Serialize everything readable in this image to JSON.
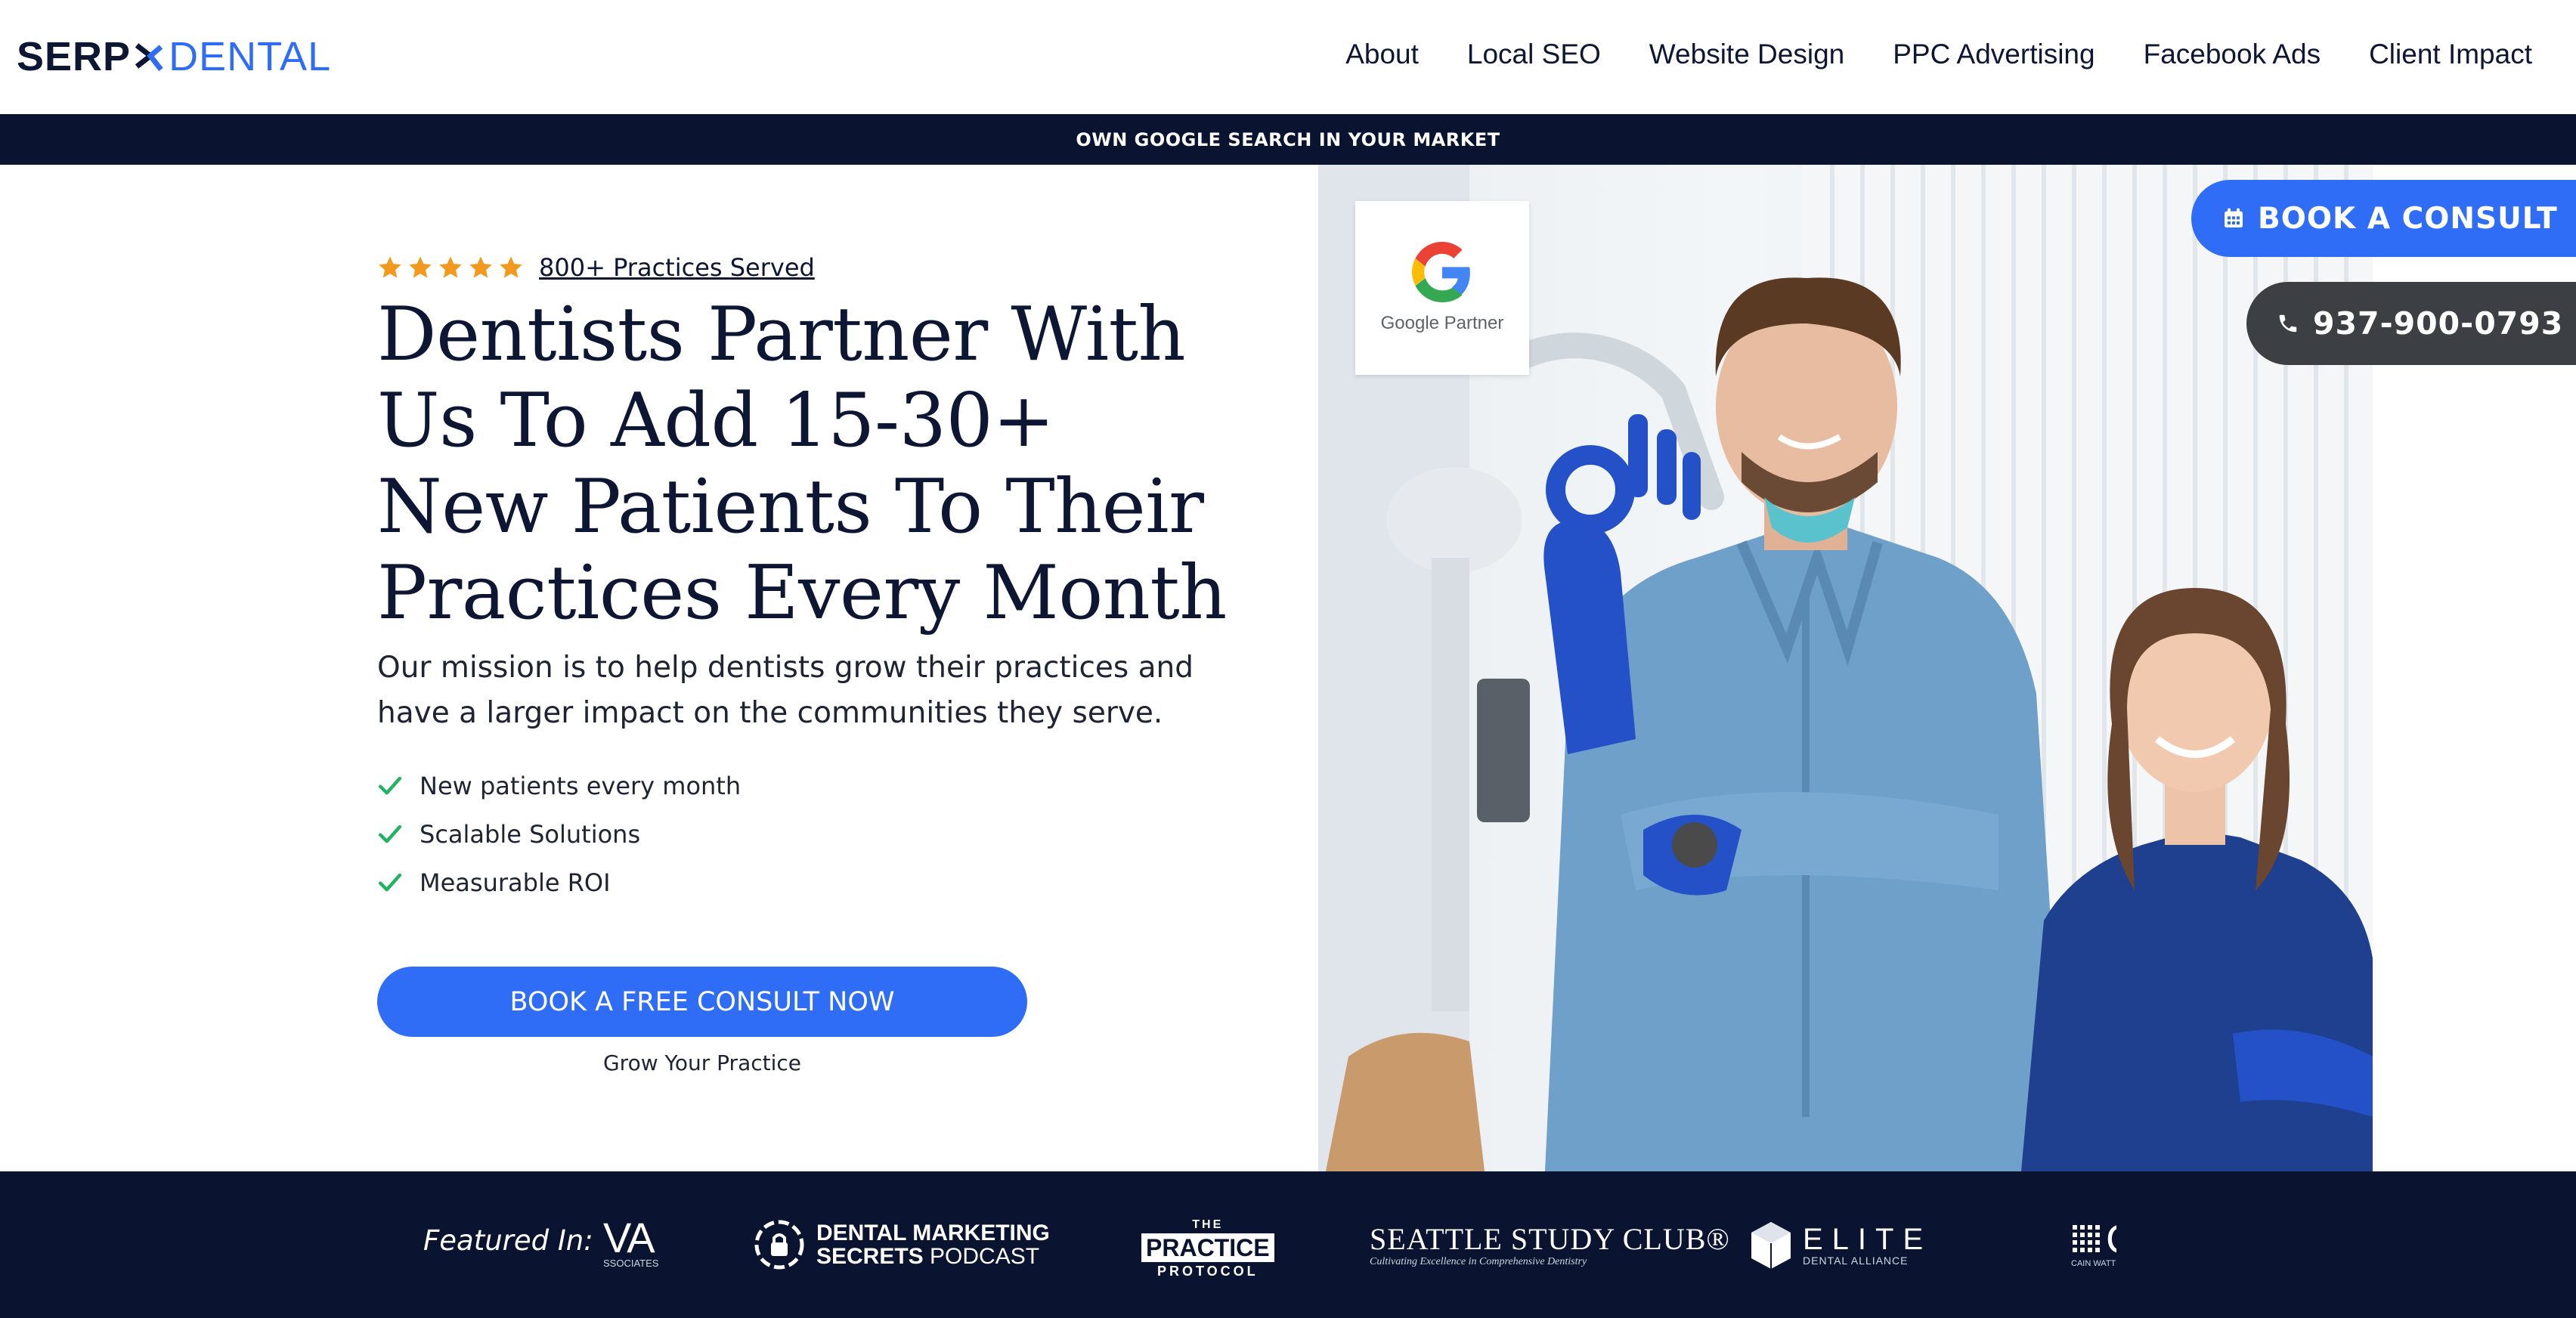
{
  "header": {
    "logo_primary": "SERP",
    "logo_secondary": "DENTAL",
    "nav": [
      "About",
      "Local SEO",
      "Website Design",
      "PPC Advertising",
      "Facebook Ads",
      "Client Impact"
    ]
  },
  "announcement": {
    "text": "OWN GOOGLE SEARCH IN YOUR MARKET"
  },
  "hero": {
    "rating": {
      "stars": 5,
      "text": "800+ Practices Served"
    },
    "headline": "Dentists Partner With Us To Add 15-30+ New Patients To Their Practices Every Month",
    "mission": "Our mission is to help dentists grow their practices and have a larger impact on the communities they serve.",
    "benefits": [
      "New patients every month",
      "Scalable Solutions",
      "Measurable ROI"
    ],
    "cta_label": "BOOK A FREE CONSULT NOW",
    "cta_sub": "Grow Your Practice"
  },
  "badge": {
    "text": "Google Partner"
  },
  "floating": {
    "book_label": "BOOK A CONSULT",
    "phone": "937-900-0793"
  },
  "featured": {
    "label": "Featured In:",
    "logos": {
      "wva": {
        "main": "VA",
        "sub": "SSOCIATES"
      },
      "dms": {
        "line1": "DENTAL MARKETING",
        "line2_bold": "SECRETS",
        "line2_light": " PODCAST"
      },
      "tpp": {
        "top": "THE",
        "middle": "PRACTICE",
        "bottom": "PROTOCOL"
      },
      "ssc": {
        "main": "SEATTLE STUDY CLUB®",
        "tagline": "Cultivating Excellence in Comprehensive Dentistry"
      },
      "elite": {
        "main": "ELITE",
        "sub": "DENTAL ALLIANCE"
      },
      "cw": {
        "main": "CV",
        "sub": "CAIN WATTERS & A"
      }
    }
  },
  "colors": {
    "brand_blue": "#2f6df6",
    "navy": "#0a1430",
    "star": "#f29a1f",
    "check": "#22b35e",
    "phone_bg": "#3c3f44"
  },
  "icons": {
    "book": "calendar-icon",
    "phone": "phone-icon",
    "star": "star-icon",
    "check": "check-icon"
  }
}
